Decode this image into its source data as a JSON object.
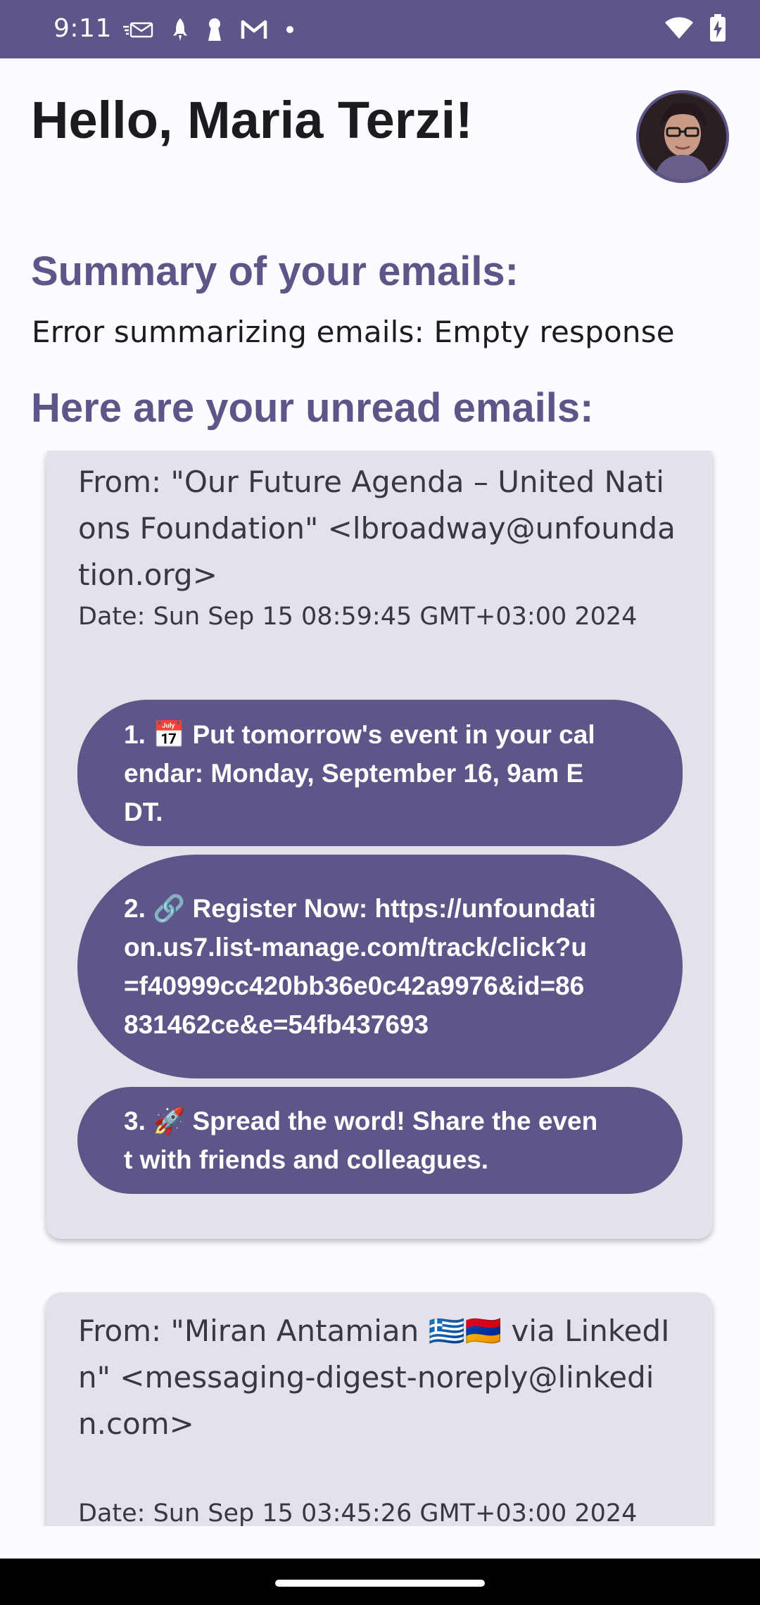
{
  "status_bar": {
    "time": "9:11",
    "icons": [
      "email-icon",
      "rocket-icon",
      "keyhole-icon",
      "gmail-icon",
      "dot-icon",
      "wifi-icon",
      "battery-charging-icon"
    ]
  },
  "header": {
    "greeting": "Hello, Maria Terzi!",
    "avatar_icon": "user-avatar"
  },
  "summary": {
    "title": "Summary of your emails:",
    "text": "Error summarizing emails: Empty response"
  },
  "unread": {
    "title": "Here are your unread emails:",
    "emails": [
      {
        "from": "From: \"Our Future Agenda – United Nations Foundation\" <lbroadway@unfoundation.org>",
        "date": "Date: Sun Sep 15 08:59:45 GMT+03:00 2024",
        "actions": [
          "1. 📅 Put tomorrow's event in your calendar: Monday, September 16, 9am EDT.",
          "2. 🔗 Register Now: https://unfoundation.us7.list-manage.com/track/click?u=f40999cc420bb36e0c42a9976&id=86831462ce&e=54fb437693",
          "3. 🚀 Spread the word! Share the event with friends and colleagues."
        ]
      },
      {
        "from": "From: \"Miran Antamian 🇬🇷🇦🇲 via LinkedIn\" <messaging-digest-noreply@linkedin.com>",
        "date": "Date: Sun Sep 15 03:45:26 GMT+03:00 2024"
      }
    ]
  },
  "colors": {
    "primary": "#5c5689",
    "card_background": "#e5e1ea",
    "page_background": "#fdfbff",
    "text": "#1c1b1f"
  }
}
